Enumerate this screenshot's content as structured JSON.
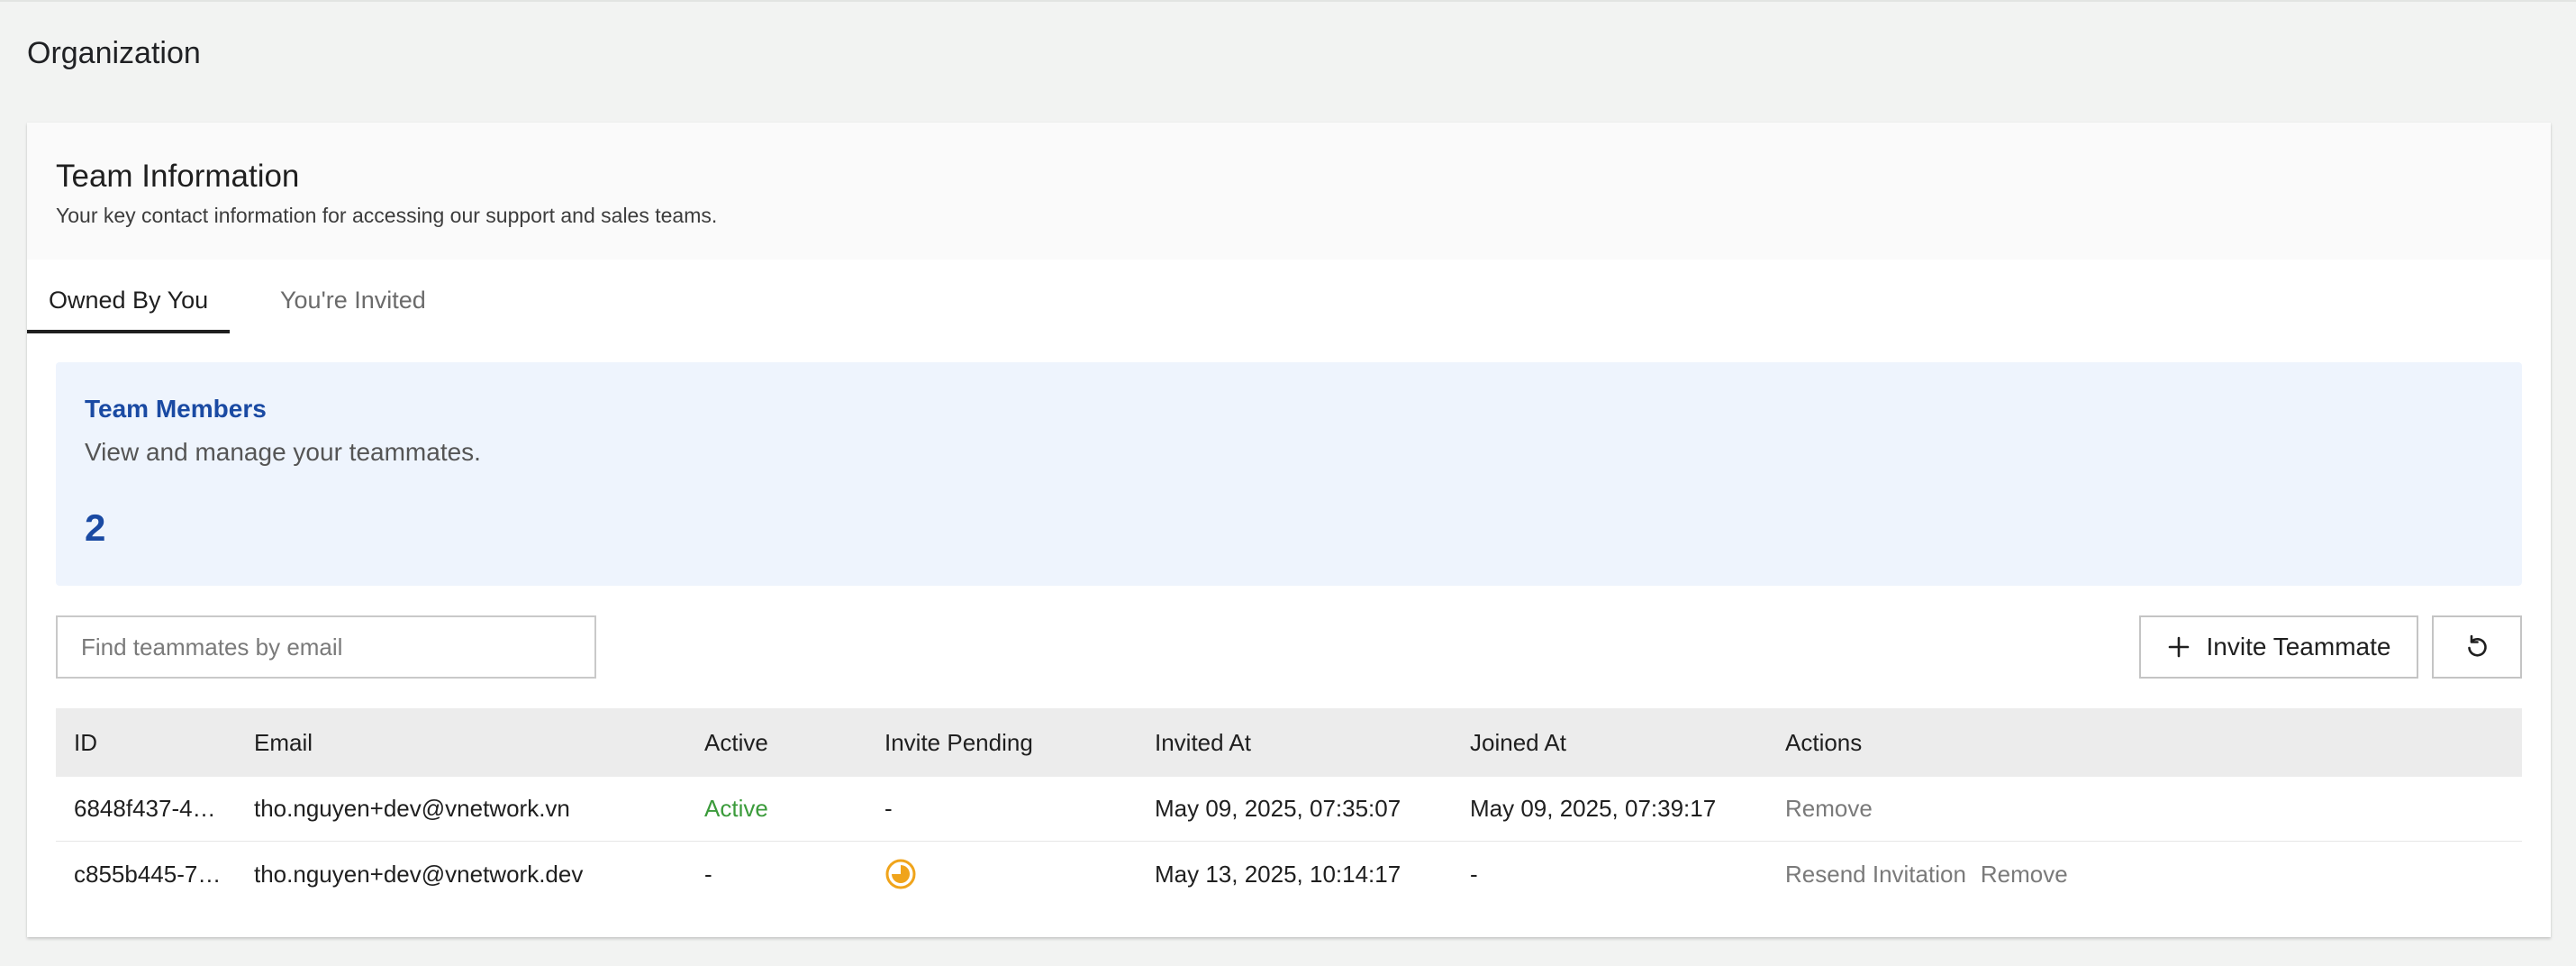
{
  "page": {
    "title": "Organization"
  },
  "card": {
    "title": "Team Information",
    "subtitle": "Your key contact information for accessing our support and sales teams."
  },
  "tabs": [
    {
      "label": "Owned By You",
      "active": true
    },
    {
      "label": "You're Invited",
      "active": false
    }
  ],
  "members": {
    "title": "Team Members",
    "description": "View and manage your teammates.",
    "count": "2"
  },
  "search": {
    "placeholder": "Find teammates by email",
    "value": ""
  },
  "toolbar": {
    "invite_label": "Invite Teammate",
    "invite_icon": "plus-icon",
    "refresh_icon": "refresh-icon"
  },
  "table": {
    "headers": [
      "ID",
      "Email",
      "Active",
      "Invite Pending",
      "Invited At",
      "Joined At",
      "Actions"
    ],
    "rows": [
      {
        "id": "6848f437-4…",
        "email": "tho.nguyen+dev@vnetwork.vn",
        "active": "Active",
        "invite_pending": "-",
        "invited_at": "May 09, 2025, 07:35:07",
        "joined_at": "May 09, 2025, 07:39:17",
        "actions": [
          "Remove"
        ]
      },
      {
        "id": "c855b445-7…",
        "email": "tho.nguyen+dev@vnetwork.dev",
        "active": "-",
        "invite_pending_icon": "pending-clock-icon",
        "invited_at": "May 13, 2025, 10:14:17",
        "joined_at": "-",
        "actions": [
          "Resend Invitation",
          "Remove"
        ]
      }
    ]
  },
  "colors": {
    "accent": "#1a4aa3",
    "active_status": "#3b9b3b",
    "pending_icon": "#f0a41b",
    "members_bg": "#eef4fd"
  }
}
